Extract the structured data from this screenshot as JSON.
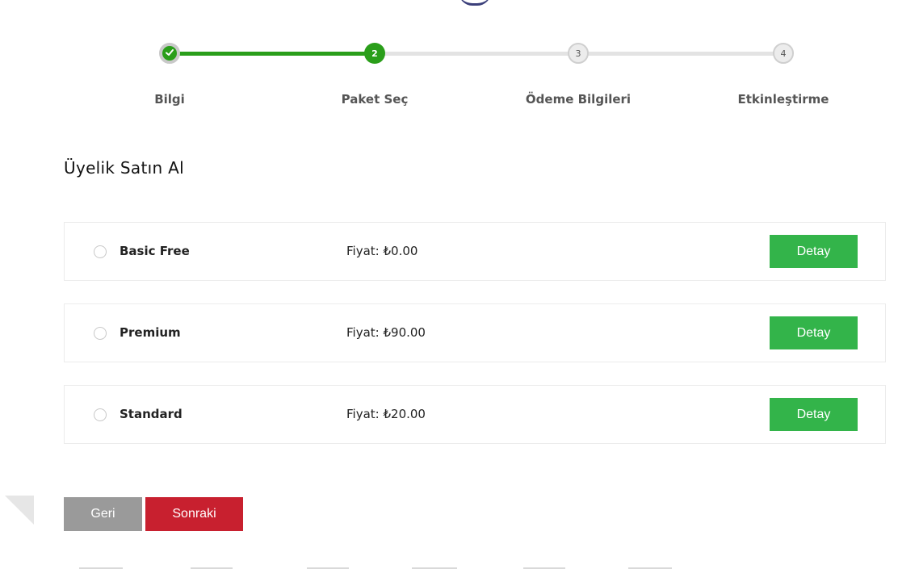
{
  "colors": {
    "accent_green": "#2a9e1a",
    "button_green": "#33b44a",
    "next_red": "#c8202f",
    "back_gray": "#9a9a9a"
  },
  "stepper": {
    "current_step": 2,
    "steps": [
      {
        "number": "",
        "icon": "check-icon",
        "label": "Bilgi",
        "state": "done"
      },
      {
        "number": "2",
        "label": "Paket Seç",
        "state": "active"
      },
      {
        "number": "3",
        "label": "Ödeme Bilgileri",
        "state": "pending"
      },
      {
        "number": "4",
        "label": "Etkinleştirme",
        "state": "pending"
      }
    ]
  },
  "page_title": "Üyelik Satın Al",
  "packages": [
    {
      "name": "Basic Free",
      "price": "Fiyat: ₺0.00",
      "detail_label": "Detay",
      "selected": false
    },
    {
      "name": "Premium",
      "price": "Fiyat: ₺90.00",
      "detail_label": "Detay",
      "selected": false
    },
    {
      "name": "Standard",
      "price": "Fiyat: ₺20.00",
      "detail_label": "Detay",
      "selected": false
    }
  ],
  "actions": {
    "back_label": "Geri",
    "next_label": "Sonraki"
  }
}
